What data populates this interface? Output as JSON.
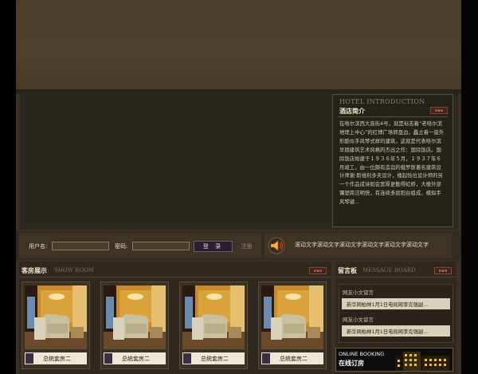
{
  "intro": {
    "title_en": "HOTEL INTRODUCTION",
    "title_cn": "酒店简介",
    "more_label": "more",
    "body": "在哈尔滨西大直街4号，就是标志着“老哈尔滨地理上中心”的红博广场转盘边，矗立着一座外形酷似手风琴式样的建筑，这就是代表哈尔滨早期建筑艺术风格的杰出之作：国际饭店。国际饭店始建于１９３６年５月，１９３７年６月竣工，由一位颇有造诣的俄罗斯著名建筑设计师谢·斯维利多夫设计，楼起恰位设计师的另一个作品成诗如会宽厚更勤得虹桥，大楼外部镶塑简洁明快，有连续多层阳台组成，模拟手风琴键..."
  },
  "login": {
    "username_label": "用户名:",
    "password_label": "密码:",
    "username_value": "",
    "password_value": "",
    "login_button": "登 录",
    "register_link": "· 注册"
  },
  "marquee": {
    "text": "滚动文字滚动文字滚动文字滚动文字滚动文字滚动文字"
  },
  "showroom": {
    "title_cn": "客房展示",
    "title_en": "SHOW ROOM",
    "more_label": "more",
    "rooms": [
      {
        "caption": "总统套房二"
      },
      {
        "caption": "总统套房二"
      },
      {
        "caption": "总统套房二"
      },
      {
        "caption": "总统套房二"
      }
    ]
  },
  "message": {
    "title_cn": "留言板",
    "title_en": "MESSAGE BOARD",
    "more_label": "more",
    "items": [
      {
        "head": "网友小文留言",
        "text": "新华网柏林1月1日电局网李克强副..."
      },
      {
        "head": "网友小文留言",
        "text": "新华网柏林1月1日电局网李克强副..."
      }
    ],
    "booking_en": "ONLINE BOOKING",
    "booking_cn": "在线订房"
  },
  "colors": {
    "background": "#3a3124",
    "accent": "#4a1f1a",
    "text_light": "#efe6cf"
  }
}
